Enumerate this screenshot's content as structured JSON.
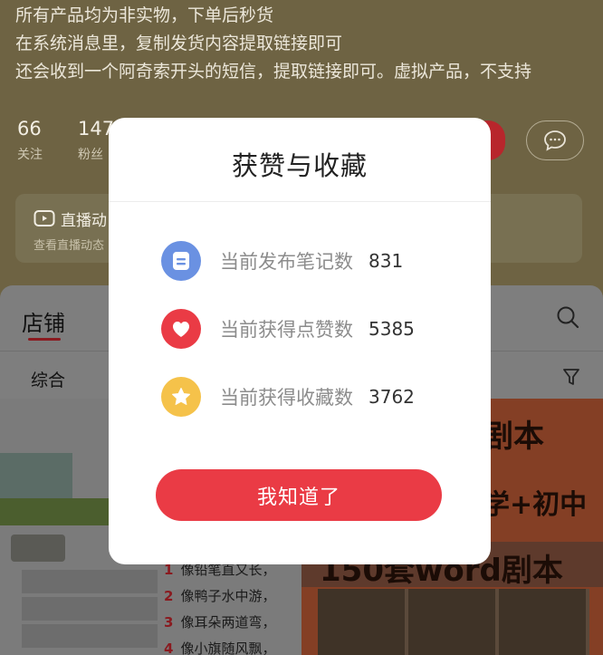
{
  "profile": {
    "bio_lines": [
      "所有产品均为非实物，下单后秒货",
      "在系统消息里，复制发货内容提取链接即可",
      "还会收到一个阿奇索开头的短信，提取链接即可。虚拟产品，不支持"
    ],
    "stats": [
      {
        "value": "66",
        "label": "关注"
      },
      {
        "value": "147",
        "label": "粉丝"
      }
    ],
    "live_card": {
      "title": "直播动",
      "subtitle": "查看直播动态"
    }
  },
  "shop": {
    "tab_label": "店铺",
    "sort_label": "综合",
    "right_product": {
      "headline1": "剧本",
      "headline2": "学+初中",
      "headline3": "150套word剧本"
    },
    "poem_lines": [
      {
        "n": "1",
        "text": "像铅笔直又长，"
      },
      {
        "n": "2",
        "text": "像鸭子水中游，"
      },
      {
        "n": "3",
        "text": "像耳朵两道弯，"
      },
      {
        "n": "4",
        "text": "像小旗随风飘，"
      }
    ]
  },
  "modal": {
    "title": "获赞与收藏",
    "rows": [
      {
        "label": "当前发布笔记数",
        "value": "831",
        "icon": "note-icon",
        "color": "#6a91e2"
      },
      {
        "label": "当前获得点赞数",
        "value": "5385",
        "icon": "heart-icon",
        "color": "#ea3b45"
      },
      {
        "label": "当前获得收藏数",
        "value": "3762",
        "icon": "star-icon",
        "color": "#f5c24a"
      }
    ],
    "confirm_label": "我知道了"
  }
}
